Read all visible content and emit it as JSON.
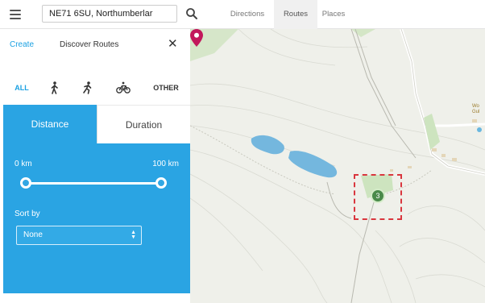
{
  "header": {
    "search_value": "NE71 6SU, Northumberlar",
    "tabs": [
      {
        "label": "Directions"
      },
      {
        "label": "Routes",
        "active": true
      },
      {
        "label": "Places"
      }
    ]
  },
  "panel": {
    "create_label": "Create",
    "title": "Discover Routes",
    "close_symbol": "✕",
    "modes": {
      "all_label": "ALL",
      "walk_icon": "walking-person-icon",
      "run_icon": "running-person-icon",
      "bike_icon": "bicycle-icon",
      "other_label": "OTHER"
    },
    "sort_tabs": {
      "distance_label": "Distance",
      "duration_label": "Duration",
      "active": "Distance"
    },
    "range": {
      "min_label": "0 km",
      "max_label": "100 km",
      "min_fraction": 0,
      "max_fraction": 1
    },
    "sort": {
      "label": "Sort by",
      "selected": "None"
    }
  },
  "map": {
    "cluster_count": "3",
    "poi_label": "Wo\nGul"
  },
  "colors": {
    "accent": "#2aa4e3",
    "link": "#1ba1e2",
    "pin": "#c2185b",
    "highlight": "#d9363e",
    "cluster": "#4a8a4a",
    "water": "#6fb4de"
  }
}
